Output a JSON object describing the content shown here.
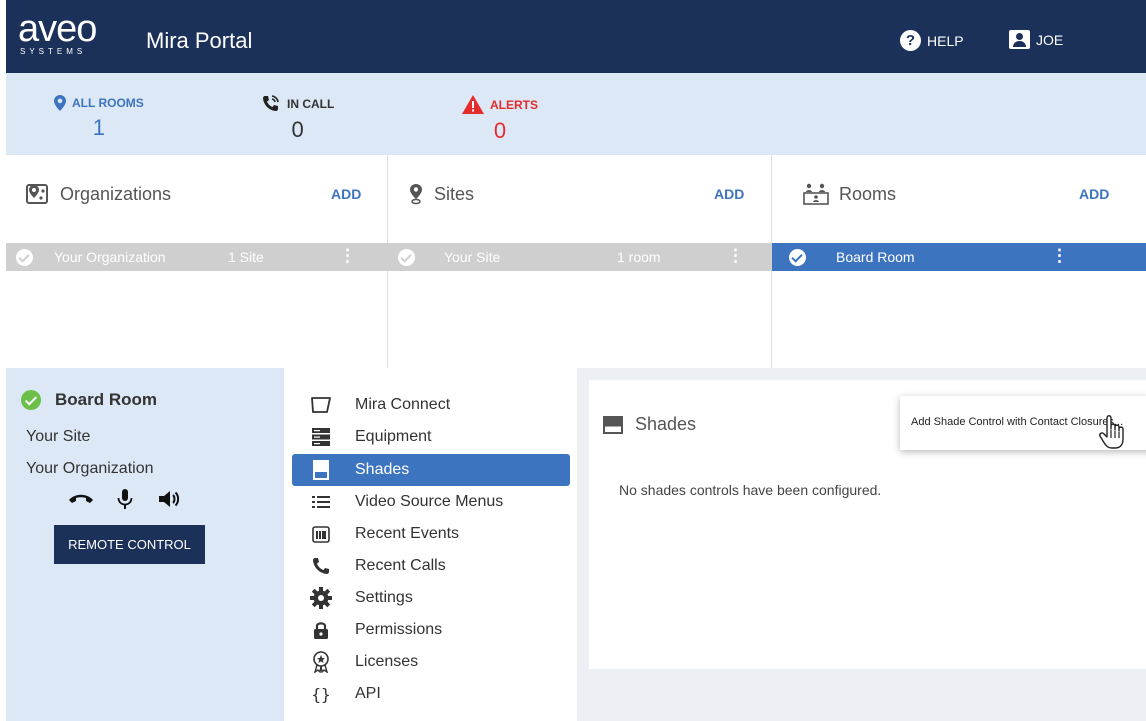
{
  "header": {
    "logo_text": "aveo",
    "logo_subtext": "SYSTEMS",
    "app_title": "Mira Portal",
    "help_label": "HELP",
    "user_label": "JOE",
    "bg_color": "#1b3159"
  },
  "stats": {
    "all_rooms": {
      "label": "ALL ROOMS",
      "value": "1",
      "icon": "location-pin-icon"
    },
    "in_call": {
      "label": "IN CALL",
      "value": "0",
      "icon": "phone-call-icon"
    },
    "alerts": {
      "label": "ALERTS",
      "value": "0",
      "icon": "warning-icon"
    }
  },
  "panels": {
    "organizations": {
      "title": "Organizations",
      "add_label": "ADD",
      "row": {
        "name": "Your Organization",
        "count": "1 Site"
      }
    },
    "sites": {
      "title": "Sites",
      "add_label": "ADD",
      "row": {
        "name": "Your Site",
        "count": "1 room"
      }
    },
    "rooms": {
      "title": "Rooms",
      "add_label": "ADD",
      "row": {
        "name": "Board Room"
      }
    }
  },
  "room_info": {
    "room_name": "Board Room",
    "site": "Your Site",
    "organization": "Your Organization",
    "remote_control_label": "REMOTE CONTROL"
  },
  "nav": {
    "items": [
      {
        "label": "Mira Connect",
        "icon": "monitor-icon"
      },
      {
        "label": "Equipment",
        "icon": "server-icon"
      },
      {
        "label": "Shades",
        "icon": "shade-icon",
        "active": true
      },
      {
        "label": "Video Source Menus",
        "icon": "list-icon"
      },
      {
        "label": "Recent Events",
        "icon": "calendar-icon"
      },
      {
        "label": "Recent Calls",
        "icon": "phone-icon"
      },
      {
        "label": "Settings",
        "icon": "gear-icon"
      },
      {
        "label": "Permissions",
        "icon": "lock-icon"
      },
      {
        "label": "Licenses",
        "icon": "badge-icon"
      },
      {
        "label": "API",
        "icon": "braces-icon"
      }
    ]
  },
  "shades": {
    "title": "Shades",
    "empty_message": "No shades controls have been configured.",
    "popup_option": "Add Shade Control with Contact Closures..."
  },
  "colors": {
    "accent": "#3d74c0",
    "alert": "#e32c2c",
    "light_panel": "#dce8f5",
    "ok_green": "#6cc04a"
  }
}
